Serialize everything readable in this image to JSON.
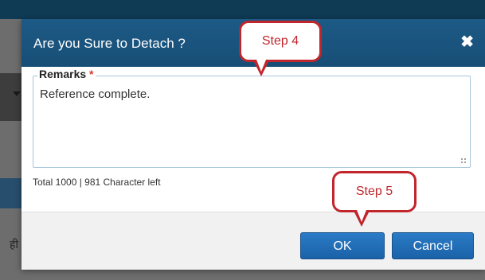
{
  "background": {
    "left_glyph": "ही"
  },
  "dialog": {
    "title": "Are you Sure to Detach ?",
    "close_icon": "close-icon",
    "remarks": {
      "label": "Remarks",
      "required_marker": "*",
      "value": "Reference complete."
    },
    "char_counter": "Total 1000 | 981 Character left",
    "buttons": {
      "ok": "OK",
      "cancel": "Cancel"
    }
  },
  "annotations": {
    "step4": "Step 4",
    "step5": "Step 5",
    "color": "#c0262c"
  },
  "colors": {
    "header": "#1d5a86",
    "button": "#2b7bc6",
    "overlay": "#6d6d6d"
  }
}
